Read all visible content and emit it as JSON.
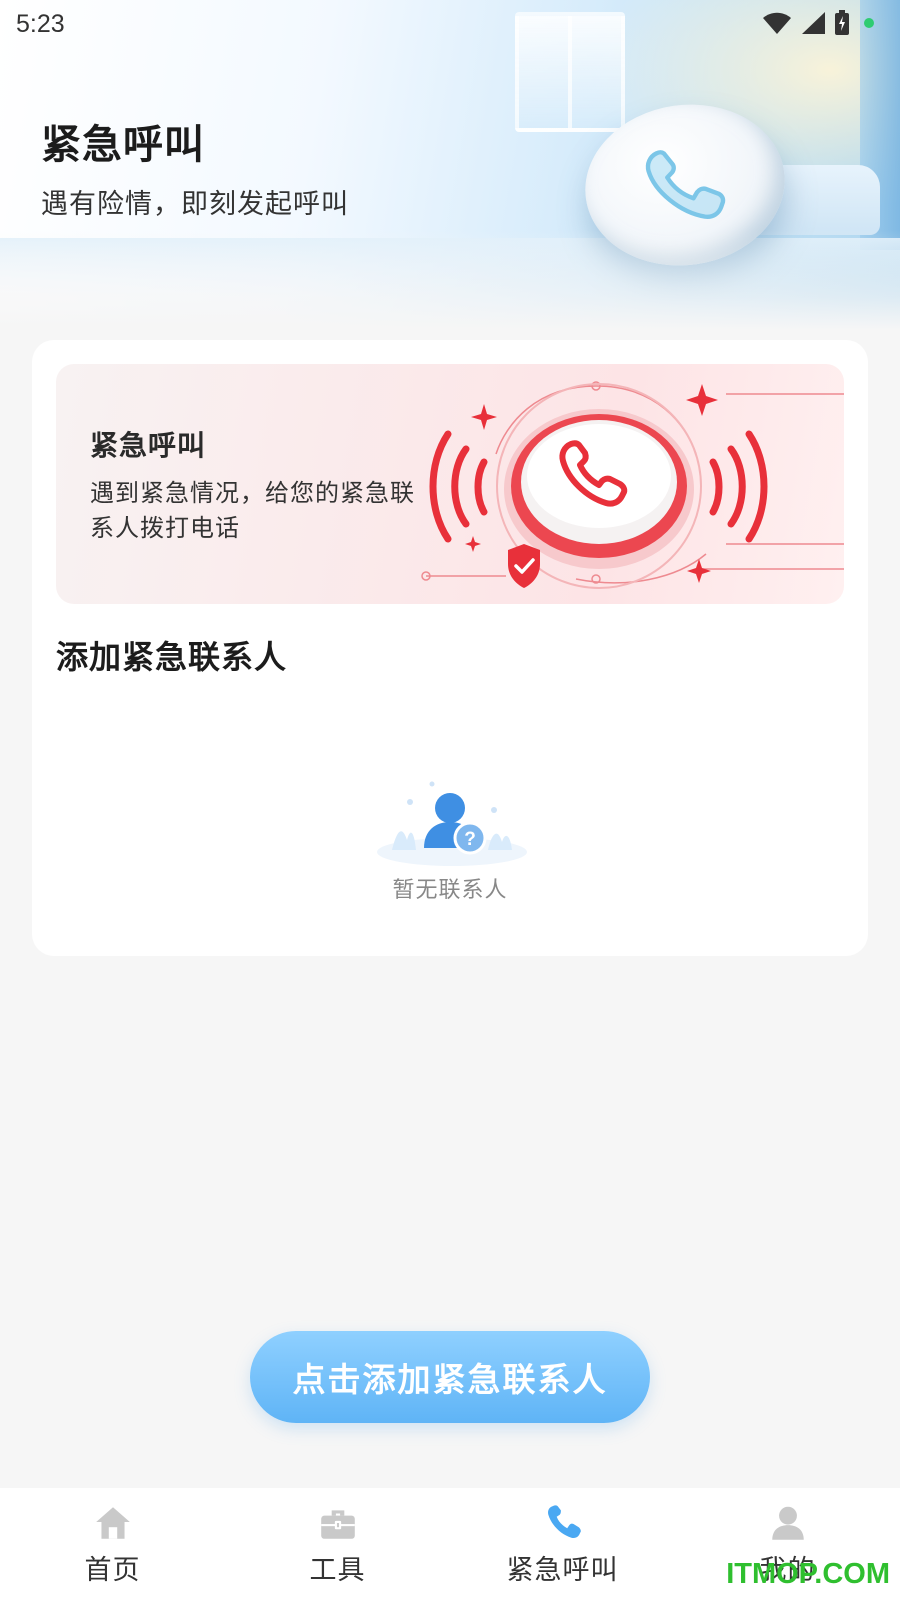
{
  "status_bar": {
    "time": "5:23",
    "icons": [
      "wifi-icon",
      "cellular-signal-icon",
      "battery-charging-icon",
      "active-dot"
    ],
    "dot_color": "#2ecc71"
  },
  "header": {
    "title": "紧急呼叫",
    "subtitle": "遇有险情，即刻发起呼叫",
    "icon": "phone-icon"
  },
  "card": {
    "banner": {
      "title": "紧急呼叫",
      "description": "遇到紧急情况，给您的紧急联系人拨打电话",
      "icon": "emergency-call-button-icon",
      "accent_color": "#e8303a"
    },
    "section_title": "添加紧急联系人",
    "empty_state": {
      "icon": "no-contact-icon",
      "text": "暂无联系人"
    }
  },
  "primary_action": {
    "label": "点击添加紧急联系人",
    "color": "#6dbdf8"
  },
  "bottom_nav": {
    "items": [
      {
        "label": "首页",
        "icon": "home-icon",
        "active": false
      },
      {
        "label": "工具",
        "icon": "toolbox-icon",
        "active": false
      },
      {
        "label": "紧急呼叫",
        "icon": "phone-icon",
        "active": true
      },
      {
        "label": "我的",
        "icon": "user-icon",
        "active": false
      }
    ],
    "active_color": "#4aa8f2",
    "inactive_color": "#c9c9c9"
  },
  "watermark": "ITMOP.COM"
}
